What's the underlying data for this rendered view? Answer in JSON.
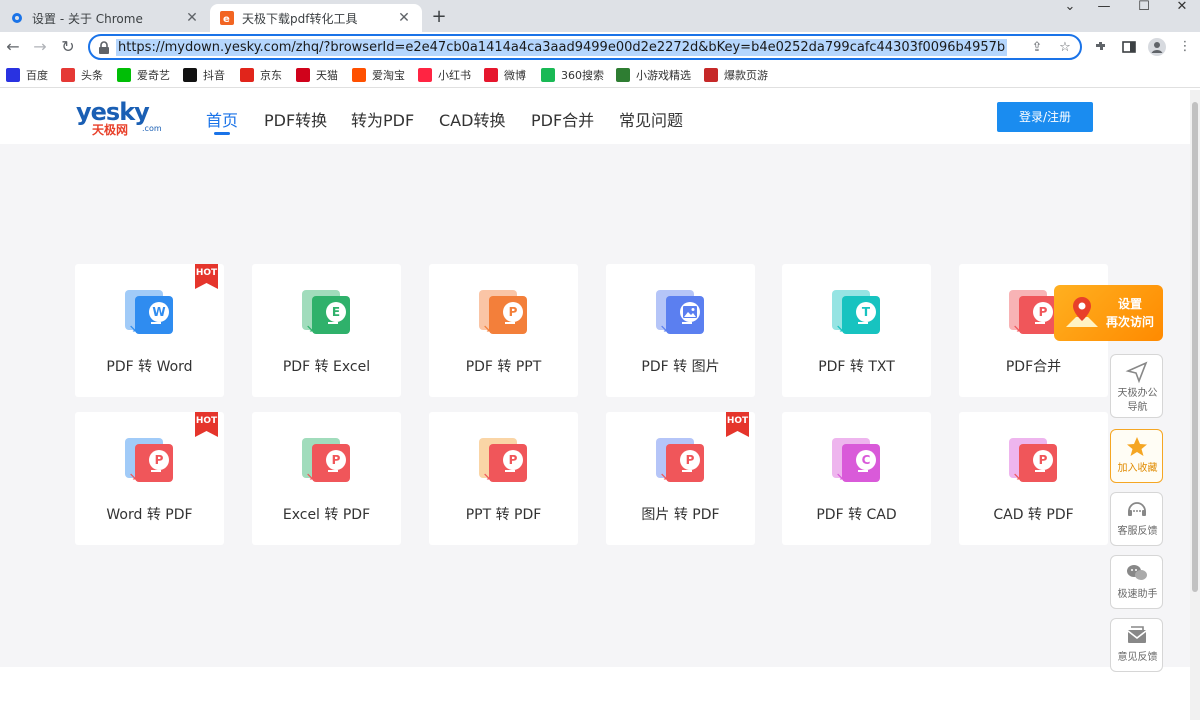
{
  "browser": {
    "tabs": [
      {
        "title": "设置 - 关于 Chrome",
        "active": false
      },
      {
        "title": "天极下载pdf转化工具",
        "active": true
      }
    ],
    "url": "https://mydown.yesky.com/zhq/?browserId=e2e47cb0a1414a4ca3aad9499e00d2e2272d&bKey=b4e0252da799cafc44303f0096b4957b",
    "bookmarks": [
      {
        "label": "百度",
        "icon": "paw-icon",
        "color": "#2932e1"
      },
      {
        "label": "头条",
        "icon": "toutiao-icon",
        "color": "#e53935"
      },
      {
        "label": "爱奇艺",
        "icon": "iqiyi-icon",
        "color": "#00be06"
      },
      {
        "label": "抖音",
        "icon": "douyin-icon",
        "color": "#111111"
      },
      {
        "label": "京东",
        "icon": "jd-icon",
        "color": "#e1251b"
      },
      {
        "label": "天猫",
        "icon": "tmall-icon",
        "color": "#d0021b"
      },
      {
        "label": "爱淘宝",
        "icon": "taobao-icon",
        "color": "#ff5000"
      },
      {
        "label": "小红书",
        "icon": "xhs-icon",
        "color": "#ff2442"
      },
      {
        "label": "微博",
        "icon": "weibo-icon",
        "color": "#e6162d"
      },
      {
        "label": "360搜索",
        "icon": "360-icon",
        "color": "#19b955"
      },
      {
        "label": "小游戏精选",
        "icon": "game-icon",
        "color": "#2e7d32"
      },
      {
        "label": "爆款页游",
        "icon": "webgame-icon",
        "color": "#c62828"
      }
    ]
  },
  "header": {
    "logo_text": "yesky",
    "logo_sub": "天极网",
    "logo_com": ".com",
    "nav": [
      "首页",
      "PDF转换",
      "转为PDF",
      "CAD转换",
      "PDF合并",
      "常见问题"
    ],
    "login_label": "登录/注册"
  },
  "tools": [
    {
      "label": "PDF 转 Word",
      "letter": "W",
      "color": "#2f8cf0",
      "hot": true
    },
    {
      "label": "PDF 转 Excel",
      "letter": "E",
      "color": "#2fb16b",
      "hot": false
    },
    {
      "label": "PDF 转 PPT",
      "letter": "P",
      "color": "#f37f3a",
      "hot": false
    },
    {
      "label": "PDF 转 图片",
      "letter": "img",
      "color": "#5b7ff0",
      "hot": false
    },
    {
      "label": "PDF 转 TXT",
      "letter": "T",
      "color": "#17c3c0",
      "hot": false
    },
    {
      "label": "PDF合并",
      "letter": "P",
      "color": "#f0565a",
      "hot": false
    },
    {
      "label": "Word 转 PDF",
      "letter": "P",
      "color": "#f0565a",
      "hot": true,
      "back": "#2f8cf0"
    },
    {
      "label": "Excel 转 PDF",
      "letter": "P",
      "color": "#f0565a",
      "hot": false,
      "back": "#2fb16b"
    },
    {
      "label": "PPT 转 PDF",
      "letter": "P",
      "color": "#f0565a",
      "hot": false,
      "back": "#f3a23a"
    },
    {
      "label": "图片 转 PDF",
      "letter": "P",
      "color": "#f0565a",
      "hot": true,
      "back": "#5b7ff0"
    },
    {
      "label": "PDF 转 CAD",
      "letter": "C",
      "color": "#d95ad9",
      "hot": false
    },
    {
      "label": "CAD 转 PDF",
      "letter": "P",
      "color": "#f0565a",
      "hot": false,
      "back": "#d95ad9"
    }
  ],
  "hot_label": "HOT",
  "promo": {
    "line1": "设置",
    "line2": "再次访问"
  },
  "side": [
    {
      "label_a": "天极办公",
      "label_b": "导航",
      "icon": "paper-plane-icon"
    },
    {
      "label_a": "加入收藏",
      "label_b": "",
      "icon": "star-icon"
    },
    {
      "label_a": "客服反馈",
      "label_b": "",
      "icon": "headset-icon"
    },
    {
      "label_a": "极速助手",
      "label_b": "",
      "icon": "wechat-icon"
    },
    {
      "label_a": "意见反馈",
      "label_b": "",
      "icon": "mail-icon"
    }
  ]
}
